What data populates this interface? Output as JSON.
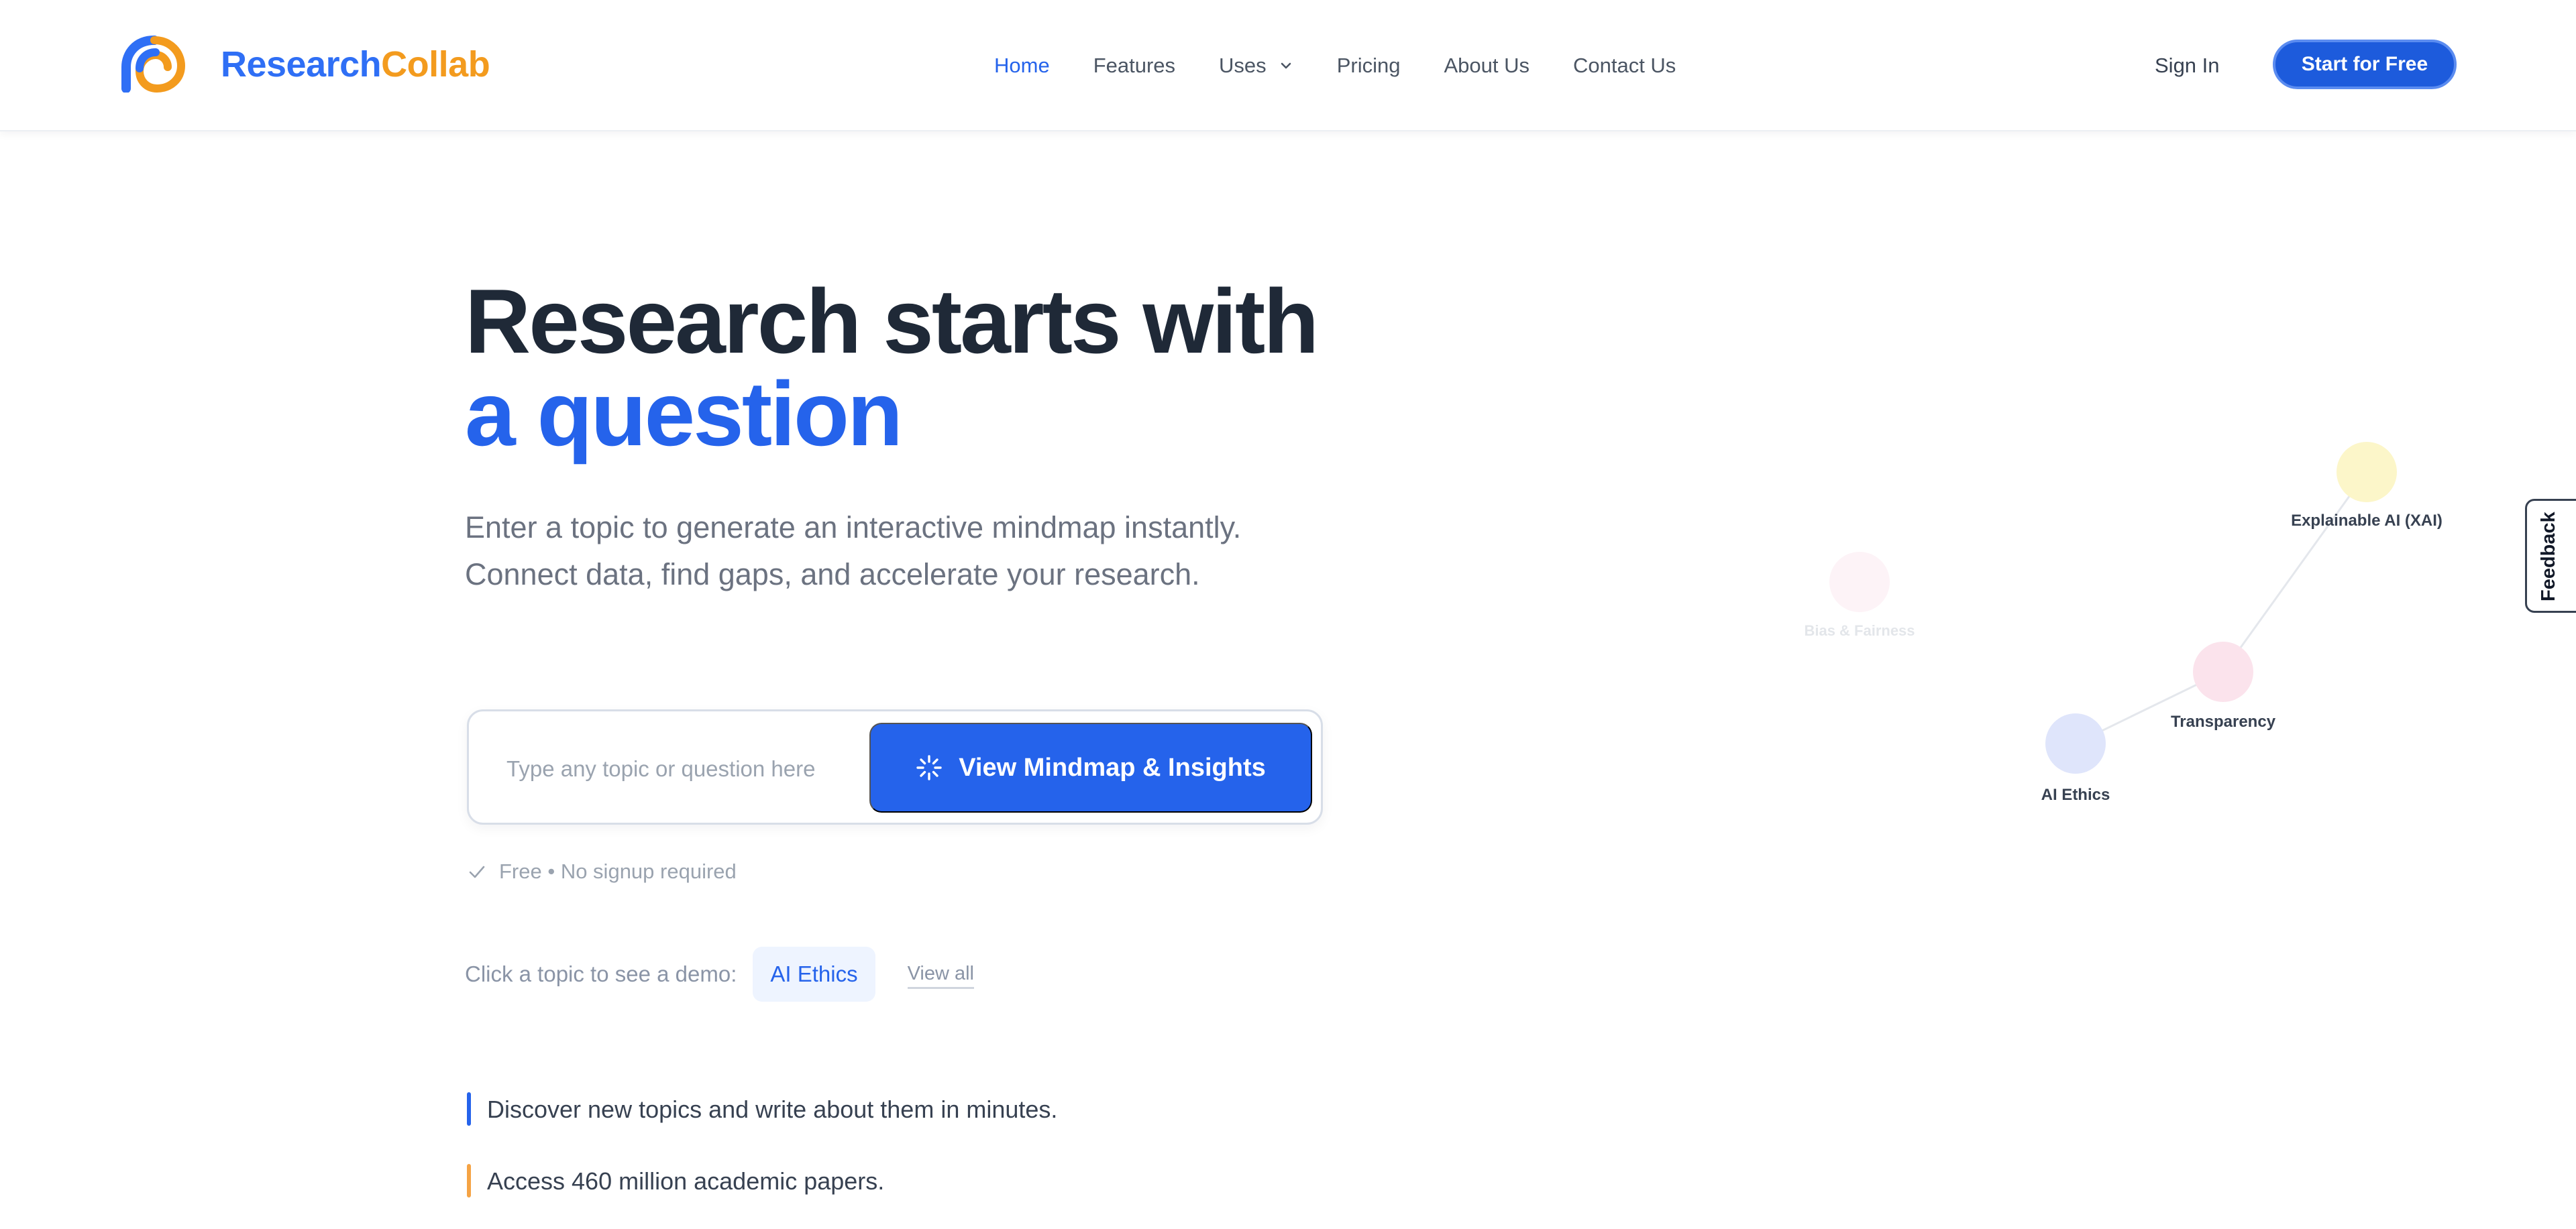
{
  "brand": {
    "name_part1": "Research",
    "name_part2": "Collab",
    "colors": {
      "blue": "#2f6ff5",
      "orange": "#f39b1e"
    }
  },
  "nav": {
    "links": [
      {
        "label": "Home",
        "active": true
      },
      {
        "label": "Features"
      },
      {
        "label": "Uses",
        "has_dropdown": true
      },
      {
        "label": "Pricing"
      },
      {
        "label": "About Us"
      },
      {
        "label": "Contact Us"
      }
    ],
    "sign_in": "Sign In",
    "cta": "Start for Free"
  },
  "hero": {
    "title_line1": "Research starts with",
    "title_line2": "a question",
    "subtitle": "Enter a topic to generate an interactive mindmap instantly. Connect data, find gaps, and accelerate your research.",
    "search": {
      "placeholder": "Type any topic or question here",
      "value": "",
      "button_label": "View Mindmap & Insights",
      "button_icon": "loading-spinner-icon"
    },
    "free_note": "Free • No signup required",
    "demo": {
      "label": "Click a topic to see a demo:",
      "topic": "AI Ethics",
      "view_all": "View all"
    },
    "bullets": [
      {
        "text": "Discover new topics and write about them in minutes.",
        "color": "#2563eb"
      },
      {
        "text": "Access 460 million academic papers.",
        "color": "#f5a344"
      }
    ]
  },
  "mindmap": {
    "nodes": [
      {
        "id": "ai-ethics",
        "label": "AI Ethics",
        "color": "#dfe5fb",
        "label_color": "#374151"
      },
      {
        "id": "transparency",
        "label": "Transparency",
        "color": "#fbe3ec",
        "label_color": "#374151"
      },
      {
        "id": "xai",
        "label": "Explainable AI (XAI)",
        "color": "#fcf6c9",
        "label_color": "#374151"
      },
      {
        "id": "bias",
        "label": "Bias & Fairness",
        "color": "#fdf3f7",
        "label_color": "#e3e6ea"
      }
    ],
    "edges": [
      [
        "ai-ethics",
        "transparency"
      ],
      [
        "transparency",
        "xai"
      ]
    ]
  },
  "feedback": {
    "label": "Feedback"
  }
}
